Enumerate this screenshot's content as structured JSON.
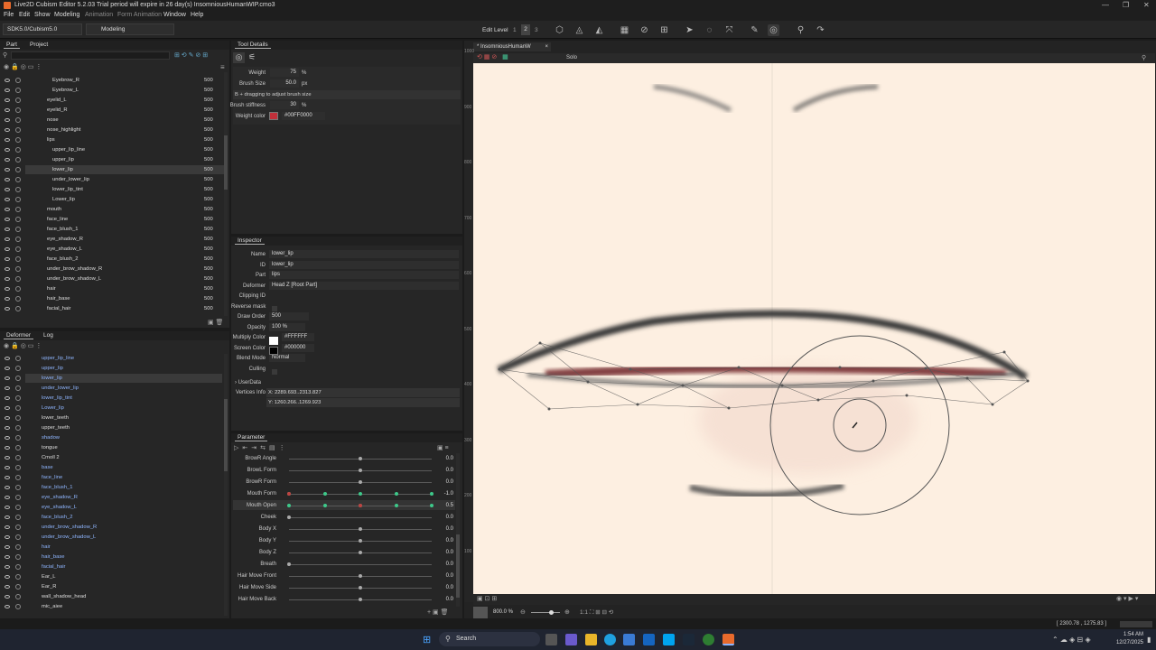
{
  "window": {
    "title": "Live2D Cubism Editor 5.2.03    Trial period will expire in 26 day(s)    InsomniousHumanWIP.cmo3"
  },
  "menu": [
    "File",
    "Edit",
    "Show",
    "Modeling",
    "Animation",
    "Form Animation",
    "Window",
    "Help"
  ],
  "toolbar": {
    "sdk": "SDK5.0/Cubism5.0",
    "mode": "Modeling",
    "edit_level_label": "Edit Level",
    "levels": [
      "1",
      "2",
      "3"
    ]
  },
  "part_panel": {
    "tabs": [
      "Part",
      "Project"
    ],
    "rows": [
      {
        "name": "Eyebrow_R",
        "value": "500"
      },
      {
        "name": "Eyebrow_L",
        "value": "500"
      },
      {
        "name": "eyelid_L",
        "value": "500"
      },
      {
        "name": "eyelid_R",
        "value": "500"
      },
      {
        "name": "nose",
        "value": "500"
      },
      {
        "name": "nose_highlight",
        "value": "500"
      },
      {
        "name": "lips",
        "value": "500"
      },
      {
        "name": "upper_lip_line",
        "value": "500"
      },
      {
        "name": "upper_lip",
        "value": "500"
      },
      {
        "name": "lower_lip",
        "value": "500"
      },
      {
        "name": "under_lower_lip",
        "value": "500"
      },
      {
        "name": "lower_lip_tint",
        "value": "500"
      },
      {
        "name": "Lower_lip",
        "value": "500"
      },
      {
        "name": "mouth",
        "value": "500"
      },
      {
        "name": "face_line",
        "value": "500"
      },
      {
        "name": "face_blush_1",
        "value": "500"
      },
      {
        "name": "eye_shadow_R",
        "value": "500"
      },
      {
        "name": "eye_shadow_L",
        "value": "500"
      },
      {
        "name": "face_blush_2",
        "value": "500"
      },
      {
        "name": "under_brow_shadow_R",
        "value": "500"
      },
      {
        "name": "under_brow_shadow_L",
        "value": "500"
      },
      {
        "name": "hair",
        "value": "500"
      },
      {
        "name": "hair_base",
        "value": "500"
      },
      {
        "name": "facial_hair",
        "value": "500"
      }
    ]
  },
  "deformer_panel": {
    "tabs": [
      "Deformer",
      "Log"
    ],
    "rows": [
      "upper_lip_line",
      "upper_lip",
      "lower_lip",
      "under_lower_lip",
      "lower_lip_tint",
      "Lower_lip",
      "lower_teeth",
      "upper_teeth",
      "shadow",
      "tongue",
      "Cmoll 2",
      "base",
      "face_line",
      "face_blush_1",
      "eye_shadow_R",
      "eye_shadow_L",
      "face_blush_2",
      "under_brow_shadow_R",
      "under_brow_shadow_L",
      "hair",
      "hair_base",
      "facial_hair",
      "Ear_L",
      "Ear_R",
      "wall_shadow_head",
      "mic_aiee"
    ]
  },
  "tool_details": {
    "title": "Tool Details",
    "weight_label": "Weight",
    "weight": "75",
    "weight_unit": "%",
    "brush_size_label": "Brush Size",
    "brush_size": "50.0",
    "brush_size_unit": "px",
    "hint": "B + dragging to adjust brush size",
    "stiffness_label": "Brush stiffness",
    "stiffness": "30",
    "stiffness_unit": "%",
    "weight_color_label": "Weight color",
    "weight_color_hex": "#00FF0000",
    "weight_color": "#c0303a"
  },
  "inspector": {
    "title": "Inspector",
    "fields": [
      {
        "label": "Name",
        "value": "lower_lip"
      },
      {
        "label": "ID",
        "value": "lower_lip"
      },
      {
        "label": "Part",
        "value": "lips"
      },
      {
        "label": "Deformer",
        "value": "Head Z  [Root Part]"
      },
      {
        "label": "Clipping ID",
        "value": ""
      },
      {
        "label": "Reverse mask",
        "value": ""
      },
      {
        "label": "Draw Order",
        "value": "500"
      },
      {
        "label": "Opacity",
        "value": "100 %"
      },
      {
        "label": "Multiply Color",
        "value": "#FFFFFF"
      },
      {
        "label": "Screen Color",
        "value": "#000000"
      },
      {
        "label": "Blend Mode",
        "value": "Normal"
      },
      {
        "label": "Culling",
        "value": ""
      }
    ],
    "userdata": "UserData",
    "vertices_label": "Vertices Info",
    "vx": "X: 2289.693..2313.827",
    "vy": "Y: 1260.266..1269.923"
  },
  "parameter": {
    "title": "Parameter",
    "rows": [
      {
        "name": "BrowR Angle",
        "value": "0.0",
        "pos": 0.5
      },
      {
        "name": "BrowL Form",
        "value": "0.0",
        "pos": 0.5
      },
      {
        "name": "BrowR Form",
        "value": "0.0",
        "pos": 0.5
      },
      {
        "name": "Mouth Form",
        "value": "-1.0",
        "pos": 0.0
      },
      {
        "name": "Mouth Open",
        "value": "0.5",
        "pos": 0.5
      },
      {
        "name": "Cheek",
        "value": "0.0",
        "pos": 0.0
      },
      {
        "name": "Body X",
        "value": "0.0",
        "pos": 0.5
      },
      {
        "name": "Body Y",
        "value": "0.0",
        "pos": 0.5
      },
      {
        "name": "Body Z",
        "value": "0.0",
        "pos": 0.5
      },
      {
        "name": "Breath",
        "value": "0.0",
        "pos": 0.0
      },
      {
        "name": "Hair Move Front",
        "value": "0.0",
        "pos": 0.5
      },
      {
        "name": "Hair Move Side",
        "value": "0.0",
        "pos": 0.5
      },
      {
        "name": "Hair Move Back",
        "value": "0.0",
        "pos": 0.5
      }
    ]
  },
  "viewport": {
    "tab": "* InsomniousHumanW",
    "solo": "Solo",
    "ruler": [
      "1000",
      "900",
      "800",
      "700",
      "600",
      "500",
      "400",
      "300",
      "200",
      "100"
    ],
    "zoom": "800.0 %",
    "coords": "[ 2300.78 , 1275.83 ]",
    "background": "#fdefe1"
  },
  "taskbar": {
    "search": "Search",
    "time": "1:54 AM",
    "date": "12/27/2025"
  }
}
